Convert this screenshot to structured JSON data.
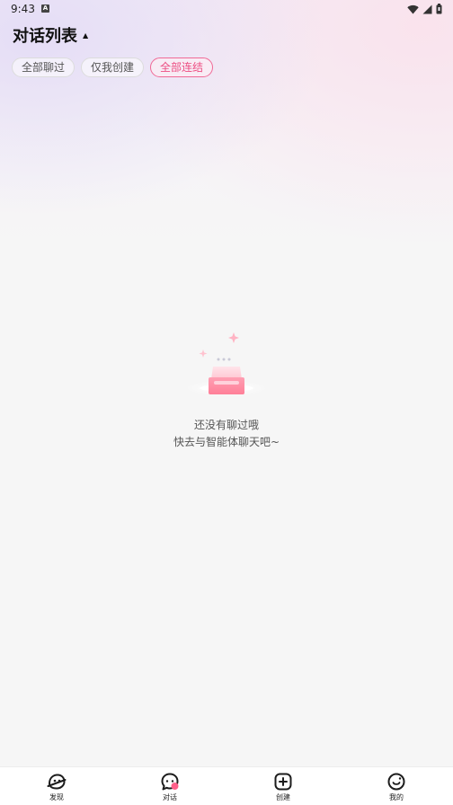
{
  "status_bar": {
    "time": "9:43",
    "notification_icon_letter": "A",
    "icons": [
      "wifi-icon",
      "signal-icon",
      "battery-icon"
    ]
  },
  "header": {
    "title": "对话列表",
    "title_caret": "▲"
  },
  "filters": [
    {
      "label": "全部聊过",
      "active": false
    },
    {
      "label": "仅我创建",
      "active": false
    },
    {
      "label": "全部连结",
      "active": true
    }
  ],
  "empty_state": {
    "line1": "还没有聊过哦",
    "line2": "快去与智能体聊天吧~"
  },
  "bottom_nav": [
    {
      "label": "发现",
      "icon": "discover-icon"
    },
    {
      "label": "对话",
      "icon": "chat-icon"
    },
    {
      "label": "创建",
      "icon": "create-icon"
    },
    {
      "label": "我的",
      "icon": "profile-icon"
    }
  ],
  "colors": {
    "accent": "#ec4e83",
    "background": "#f6f6f6",
    "nav_background": "#ffffff"
  }
}
